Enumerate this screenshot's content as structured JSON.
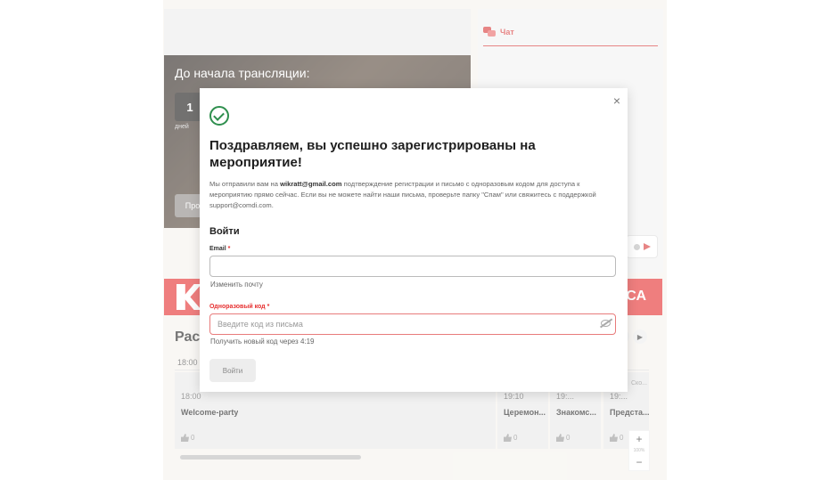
{
  "background": {
    "player": {
      "countdown_title": "До начала трансляции:",
      "count_value": "1",
      "count_unit": "дней",
      "button_label": "Про"
    },
    "chat": {
      "tab_label": "Чат"
    },
    "banner": {
      "text": "РСА"
    },
    "schedule": {
      "title": "Рас",
      "time_header": "18:00",
      "events": [
        {
          "time": "18:00",
          "title": "Welcome-party",
          "likes": "0"
        },
        {
          "time": "19:10",
          "title": "Церемон...",
          "likes": "0"
        },
        {
          "time": "19:...",
          "title": "Знакомс...",
          "likes": "0"
        },
        {
          "time": "19:...",
          "title": "Предста...",
          "likes": "0"
        },
        {
          "time": "Ско..."
        }
      ]
    },
    "zoom": {
      "level": "100%"
    }
  },
  "modal": {
    "title": "Поздравляем, вы успешно зарегистрированы на мероприятие!",
    "description_prefix": "Мы отправили вам на ",
    "email_bold": "wikratt@gmail.com",
    "description_suffix": " подтверждение регистрации и письмо с одноразовым кодом для доступа к мероприятию прямо сейчас. Если вы не можете найти наши письма, проверьте папку \"Спам\" или свяжитесь с поддержкой support@comdi.com.",
    "login_heading": "Войти",
    "email_label": "Email",
    "email_value": "",
    "change_email_link": "Изменить почту",
    "code_label": "Одноразовый код",
    "code_placeholder": "Введите код из письма",
    "resend_text": "Получить новый код через",
    "resend_timer": "4:19",
    "login_button": "Войти",
    "close_glyph": "×",
    "required_mark": "*"
  }
}
